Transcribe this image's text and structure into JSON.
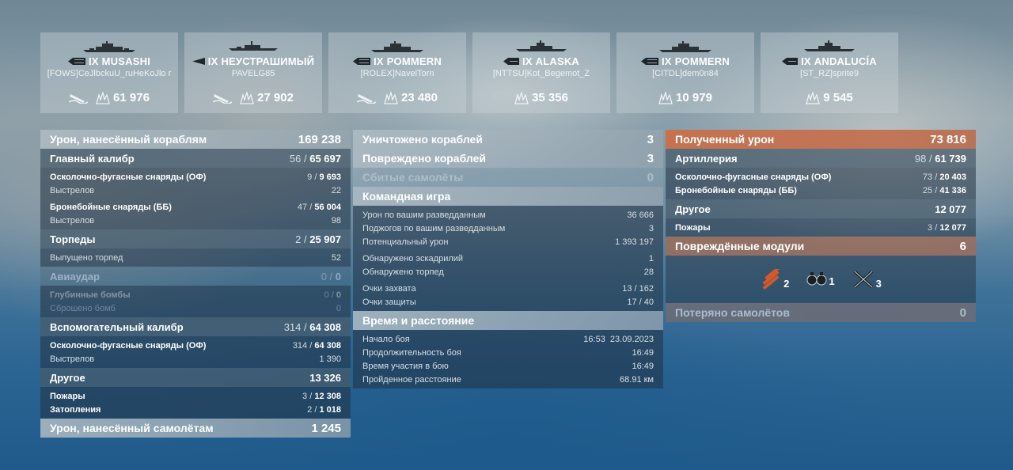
{
  "ships": [
    {
      "tier": "IX",
      "name": "MUSASHI",
      "player": "[FOWS]CeJlbckuU_ruHeKoJlo r",
      "damage": "61 976",
      "torpedo_icon": true
    },
    {
      "tier": "IX",
      "name": "НЕУСТРАШИМЫЙ",
      "player": "PAVELG85",
      "damage": "27 902",
      "torpedo_icon": true
    },
    {
      "tier": "IX",
      "name": "POMMERN",
      "player": "[ROLEX]NavelTorn",
      "damage": "23 480",
      "torpedo_icon": true
    },
    {
      "tier": "IX",
      "name": "ALASKA",
      "player": "[NTTSU]Kot_Begemot_Z",
      "damage": "35 356",
      "torpedo_icon": false
    },
    {
      "tier": "IX",
      "name": "POMMERN",
      "player": "[CITDL]dem0n84",
      "damage": "10 979",
      "torpedo_icon": false
    },
    {
      "tier": "IX",
      "name": "ANDALUCÍA",
      "player": "[ST_RZ]sprite9",
      "damage": "9 545",
      "torpedo_icon": false
    }
  ],
  "left": {
    "damage_ships": {
      "label": "Урон, нанесённый кораблям",
      "value": "169 238"
    },
    "main_battery": {
      "label": "Главный калибр",
      "hit": "56",
      "total": "65 697"
    },
    "mb_he": {
      "label": "Осколочно-фугасные снаряды (ОФ)",
      "hit": "9",
      "total": "9 693"
    },
    "mb_he_shots": {
      "label": "Выстрелов",
      "value": "22"
    },
    "mb_ap": {
      "label": "Бронебойные снаряды (ББ)",
      "hit": "47",
      "total": "56 004"
    },
    "mb_ap_shots": {
      "label": "Выстрелов",
      "value": "98"
    },
    "torpedoes": {
      "label": "Торпеды",
      "hit": "2",
      "total": "25 907"
    },
    "torps_launched": {
      "label": "Выпущено торпед",
      "value": "52"
    },
    "airstrike": {
      "label": "Авиаудар",
      "hit": "0",
      "total": "0"
    },
    "depth_charges": {
      "label": "Глубинные бомбы",
      "hit": "0",
      "total": "0"
    },
    "bombs_dropped": {
      "label": "Сброшено бомб",
      "value": "0"
    },
    "secondary": {
      "label": "Вспомогательный калибр",
      "hit": "314",
      "total": "64 308"
    },
    "sec_he": {
      "label": "Осколочно-фугасные снаряды (ОФ)",
      "hit": "314",
      "total": "64 308"
    },
    "sec_shots": {
      "label": "Выстрелов",
      "value": "1 390"
    },
    "other": {
      "label": "Другое",
      "value": "13 326"
    },
    "fires": {
      "label": "Пожары",
      "hit": "3",
      "total": "12 308"
    },
    "floods": {
      "label": "Затопления",
      "hit": "2",
      "total": "1 018"
    },
    "damage_planes": {
      "label": "Урон, нанесённый самолётам",
      "value": "1 245"
    }
  },
  "middle": {
    "destroyed": {
      "label": "Уничтожено кораблей",
      "value": "3"
    },
    "damaged": {
      "label": "Повреждено кораблей",
      "value": "3"
    },
    "planes_shot": {
      "label": "Сбитые самолёты",
      "value": "0"
    },
    "team_play": {
      "label": "Командная игра"
    },
    "spot_damage": {
      "label": "Урон по вашим разведданным",
      "value": "36 666"
    },
    "spot_fires": {
      "label": "Поджогов по вашим разведданным",
      "value": "3"
    },
    "potential": {
      "label": "Потенциальный урон",
      "value": "1 393 197"
    },
    "squadrons": {
      "label": "Обнаружено эскадрилий",
      "value": "1"
    },
    "torps_spotted": {
      "label": "Обнаружено торпед",
      "value": "28"
    },
    "capture": {
      "label": "Очки захвата",
      "hit": "13",
      "total": "162"
    },
    "defense": {
      "label": "Очки защиты",
      "hit": "17",
      "total": "40"
    },
    "time_distance": {
      "label": "Время и расстояние"
    },
    "battle_start": {
      "label": "Начало боя",
      "value": "16:53  23.09.2023"
    },
    "duration": {
      "label": "Продолжительность боя",
      "value": "16:49"
    },
    "participation": {
      "label": "Время участия в бою",
      "value": "16:49"
    },
    "distance": {
      "label": "Пройденное расстояние",
      "value": "68.91 км"
    }
  },
  "right": {
    "received": {
      "label": "Полученный урон",
      "value": "73 816"
    },
    "artillery": {
      "label": "Артиллерия",
      "hit": "98",
      "total": "61 739"
    },
    "art_he": {
      "label": "Осколочно-фугасные снаряды (ОФ)",
      "hit": "73",
      "total": "20 403"
    },
    "art_ap": {
      "label": "Бронебойные снаряды (ББ)",
      "hit": "25",
      "total": "41 336"
    },
    "other": {
      "label": "Другое",
      "value": "12 077"
    },
    "fires": {
      "label": "Пожары",
      "hit": "3",
      "total": "12 077"
    },
    "modules": {
      "label": "Повреждённые модули",
      "value": "6"
    },
    "module_items": [
      {
        "icon": "guns-module-icon",
        "count": "2"
      },
      {
        "icon": "engine-module-icon",
        "count": "1"
      },
      {
        "icon": "steering-module-icon",
        "count": "3"
      }
    ],
    "planes_lost": {
      "label": "Потеряно самолётов",
      "value": "0"
    }
  },
  "colors": {
    "accent_orange": "#cd6e46",
    "header_light": "#afbcc4",
    "panel_dark": "#233241"
  }
}
